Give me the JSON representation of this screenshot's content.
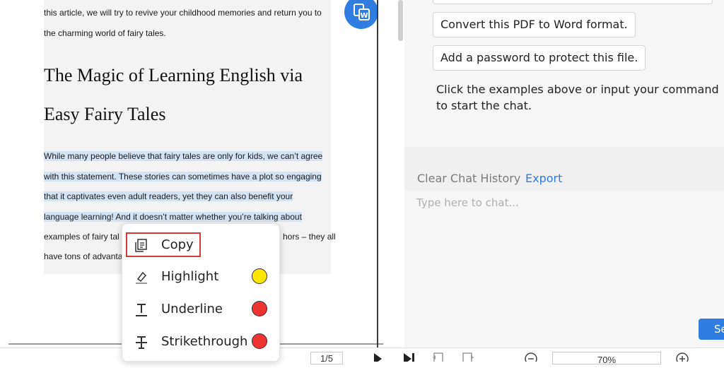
{
  "document": {
    "intro_lines": [
      "this article, we will try to revive your childhood memories and return you to",
      "the charming world of fairy tales."
    ],
    "heading_lines": [
      "The Magic of Learning English via",
      "Easy Fairy Tales"
    ],
    "paragraph_lines": [
      "While many people believe that fairy tales are only for kids, we can’t agree",
      "with this statement. These stories can sometimes have a plot so engaging",
      "that it captivates even adult readers, yet they can also benefit your",
      "language learning! And it doesn’t matter whether you’re talking about",
      "examples of fairy tal",
      "have tons of advanta"
    ],
    "paragraph_line5_tail": "hors – they all"
  },
  "assistant": {
    "suggestions": [
      "Convert this PDF to Word format.",
      "Add a password to protect this file."
    ],
    "hint": "Click the examples above or input your command to start the chat.",
    "clear_history_label": "Clear Chat History",
    "export_label": "Export",
    "chat_placeholder": "Type here to chat...",
    "send_label": "Se"
  },
  "context_menu": {
    "items": [
      {
        "label": "Copy",
        "icon": "copy-icon"
      },
      {
        "label": "Highlight",
        "icon": "highlighter-icon",
        "color": "#ffe600"
      },
      {
        "label": "Underline",
        "icon": "underline-icon",
        "color": "#ee3333"
      },
      {
        "label": "Strikethrough",
        "icon": "strikethrough-icon",
        "color": "#ee3333"
      }
    ]
  },
  "toolbar": {
    "page_indicator": "1/5",
    "zoom": "70%"
  },
  "colors": {
    "accent": "#2f7de1",
    "selection": "#d4e3f3",
    "copy_frame": "#d33c3c"
  }
}
